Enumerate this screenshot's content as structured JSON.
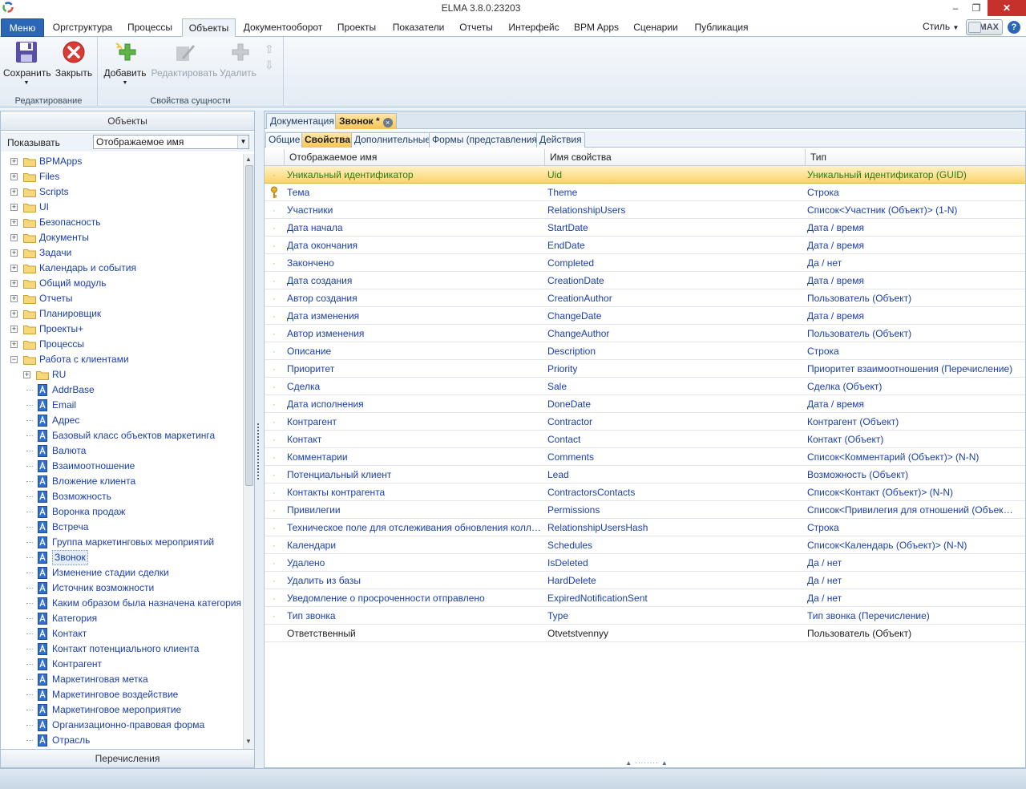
{
  "window": {
    "title": "ELMA 3.8.0.23203"
  },
  "menu": {
    "tabs": [
      {
        "label": "Меню",
        "kind": "menu"
      },
      {
        "label": "Оргструктура"
      },
      {
        "label": "Процессы"
      },
      {
        "label": "Объекты",
        "active": true
      },
      {
        "label": "Документооборот"
      },
      {
        "label": "Проекты"
      },
      {
        "label": "Показатели"
      },
      {
        "label": "Отчеты"
      },
      {
        "label": "Интерфейс"
      },
      {
        "label": "BPM Apps"
      },
      {
        "label": "Сценарии"
      },
      {
        "label": "Публикация"
      }
    ],
    "style_label": "Стиль",
    "max_label": "MAX",
    "help": "?"
  },
  "ribbon": {
    "groups": [
      {
        "label": "Редактирование",
        "buttons": [
          {
            "label": "Сохранить",
            "icon": "save-icon",
            "enabled": true
          },
          {
            "label": "Закрыть",
            "icon": "close-icon",
            "enabled": true
          }
        ]
      },
      {
        "label": "Свойства сущности",
        "buttons": [
          {
            "label": "Добавить",
            "icon": "add-icon",
            "enabled": true
          },
          {
            "label": "Редактировать",
            "icon": "edit-icon",
            "enabled": false
          },
          {
            "label": "Удалить",
            "icon": "delete-icon",
            "enabled": false
          }
        ]
      }
    ]
  },
  "left": {
    "header": "Объекты",
    "show_label": "Показывать",
    "show_value": "Отображаемое имя",
    "footer": "Перечисления",
    "tree": [
      {
        "label": "BPMApps",
        "type": "folder",
        "level": 0,
        "exp": "+"
      },
      {
        "label": "Files",
        "type": "folder",
        "level": 0,
        "exp": "+"
      },
      {
        "label": "Scripts",
        "type": "folder",
        "level": 0,
        "exp": "+"
      },
      {
        "label": "UI",
        "type": "folder",
        "level": 0,
        "exp": "+"
      },
      {
        "label": "Безопасность",
        "type": "folder",
        "level": 0,
        "exp": "+"
      },
      {
        "label": "Документы",
        "type": "folder",
        "level": 0,
        "exp": "+"
      },
      {
        "label": "Задачи",
        "type": "folder",
        "level": 0,
        "exp": "+"
      },
      {
        "label": "Календарь и события",
        "type": "folder",
        "level": 0,
        "exp": "+"
      },
      {
        "label": "Общий модуль",
        "type": "folder",
        "level": 0,
        "exp": "+"
      },
      {
        "label": "Отчеты",
        "type": "folder",
        "level": 0,
        "exp": "+"
      },
      {
        "label": "Планировщик",
        "type": "folder",
        "level": 0,
        "exp": "+"
      },
      {
        "label": "Проекты+",
        "type": "folder",
        "level": 0,
        "exp": "+"
      },
      {
        "label": "Процессы",
        "type": "folder",
        "level": 0,
        "exp": "+"
      },
      {
        "label": "Работа с клиентами",
        "type": "folder",
        "level": 0,
        "exp": "−"
      },
      {
        "label": "RU",
        "type": "folder",
        "level": 1,
        "exp": "+"
      },
      {
        "label": "AddrBase",
        "type": "entity",
        "level": 1
      },
      {
        "label": "Email",
        "type": "entity",
        "level": 1
      },
      {
        "label": "Адрес",
        "type": "entity",
        "level": 1
      },
      {
        "label": "Базовый класс объектов маркетинга",
        "type": "entity",
        "level": 1
      },
      {
        "label": "Валюта",
        "type": "entity",
        "level": 1
      },
      {
        "label": "Взаимоотношение",
        "type": "entity",
        "level": 1
      },
      {
        "label": "Вложение клиента",
        "type": "entity",
        "level": 1
      },
      {
        "label": "Возможность",
        "type": "entity",
        "level": 1
      },
      {
        "label": "Воронка продаж",
        "type": "entity",
        "level": 1
      },
      {
        "label": "Встреча",
        "type": "entity",
        "level": 1
      },
      {
        "label": "Группа маркетинговых мероприятий",
        "type": "entity",
        "level": 1
      },
      {
        "label": "Звонок",
        "type": "entity",
        "level": 1,
        "selected": true
      },
      {
        "label": "Изменение стадии сделки",
        "type": "entity",
        "level": 1
      },
      {
        "label": "Источник возможности",
        "type": "entity",
        "level": 1
      },
      {
        "label": "Каким образом была назначена категория",
        "type": "entity",
        "level": 1
      },
      {
        "label": "Категория",
        "type": "entity",
        "level": 1
      },
      {
        "label": "Контакт",
        "type": "entity",
        "level": 1
      },
      {
        "label": "Контакт потенциального клиента",
        "type": "entity",
        "level": 1
      },
      {
        "label": "Контрагент",
        "type": "entity",
        "level": 1
      },
      {
        "label": "Маркетинговая метка",
        "type": "entity",
        "level": 1
      },
      {
        "label": "Маркетинговое воздействие",
        "type": "entity",
        "level": 1
      },
      {
        "label": "Маркетинговое мероприятие",
        "type": "entity",
        "level": 1
      },
      {
        "label": "Организационно-правовая форма",
        "type": "entity",
        "level": 1
      },
      {
        "label": "Отрасль",
        "type": "entity",
        "level": 1
      }
    ]
  },
  "right": {
    "doc_tabs": [
      {
        "label": "Документация"
      },
      {
        "label": "Звонок *",
        "active": true,
        "close": "×"
      }
    ],
    "sub_tabs": [
      {
        "label": "Общие"
      },
      {
        "label": "Свойства",
        "active": true
      },
      {
        "label": "Дополнительные"
      },
      {
        "label": "Формы (представления)"
      },
      {
        "label": "Действия"
      }
    ],
    "columns": [
      "Отображаемое имя",
      "Имя свойства",
      "Тип"
    ],
    "rows": [
      {
        "mark": "·",
        "display": "Уникальный идентификатор",
        "name": "Uid",
        "type": "Уникальный идентификатор (GUID)",
        "selected": true
      },
      {
        "mark": "key",
        "display": "Тема",
        "name": "Theme",
        "type": "Строка"
      },
      {
        "mark": "·",
        "display": "Участники",
        "name": "RelationshipUsers",
        "type": "Список<Участник (Объект)> (1-N)"
      },
      {
        "mark": "·",
        "display": "Дата начала",
        "name": "StartDate",
        "type": "Дата / время"
      },
      {
        "mark": "·",
        "display": "Дата окончания",
        "name": "EndDate",
        "type": "Дата / время"
      },
      {
        "mark": "·",
        "display": "Закончено",
        "name": "Completed",
        "type": "Да / нет"
      },
      {
        "mark": "·",
        "display": "Дата создания",
        "name": "CreationDate",
        "type": "Дата / время"
      },
      {
        "mark": "·",
        "display": "Автор создания",
        "name": "CreationAuthor",
        "type": "Пользователь (Объект)"
      },
      {
        "mark": "·",
        "display": "Дата изменения",
        "name": "ChangeDate",
        "type": "Дата / время"
      },
      {
        "mark": "·",
        "display": "Автор изменения",
        "name": "ChangeAuthor",
        "type": "Пользователь (Объект)"
      },
      {
        "mark": "·",
        "display": "Описание",
        "name": "Description",
        "type": "Строка"
      },
      {
        "mark": "·",
        "display": "Приоритет",
        "name": "Priority",
        "type": "Приоритет взаимоотношения (Перечисление)"
      },
      {
        "mark": "·",
        "display": "Сделка",
        "name": "Sale",
        "type": "Сделка (Объект)"
      },
      {
        "mark": "·",
        "display": "Дата исполнения",
        "name": "DoneDate",
        "type": "Дата / время"
      },
      {
        "mark": "·",
        "display": "Контрагент",
        "name": "Contractor",
        "type": "Контрагент (Объект)"
      },
      {
        "mark": "·",
        "display": "Контакт",
        "name": "Contact",
        "type": "Контакт (Объект)"
      },
      {
        "mark": "·",
        "display": "Комментарии",
        "name": "Comments",
        "type": "Список<Комментарий (Объект)> (N-N)"
      },
      {
        "mark": "·",
        "display": "Потенциальный клиент",
        "name": "Lead",
        "type": "Возможность (Объект)"
      },
      {
        "mark": "·",
        "display": "Контакты контрагента",
        "name": "ContractorsContacts",
        "type": "Список<Контакт (Объект)> (N-N)"
      },
      {
        "mark": "·",
        "display": "Привилегии",
        "name": "Permissions",
        "type": "Список<Привилегия для отношений (Объект)..."
      },
      {
        "mark": "·",
        "display": "Техническое поле для отслеживания обновления коллекции...",
        "name": "RelationshipUsersHash",
        "type": "Строка"
      },
      {
        "mark": "·",
        "display": "Календари",
        "name": "Schedules",
        "type": "Список<Календарь (Объект)> (N-N)"
      },
      {
        "mark": "·",
        "display": "Удалено",
        "name": "IsDeleted",
        "type": "Да / нет"
      },
      {
        "mark": "·",
        "display": "Удалить из базы",
        "name": "HardDelete",
        "type": "Да / нет"
      },
      {
        "mark": "·",
        "display": "Уведомление о просроченности отправлено",
        "name": "ExpiredNotificationSent",
        "type": "Да / нет"
      },
      {
        "mark": "·",
        "display": "Тип звонка",
        "name": "Type",
        "type": "Тип звонка (Перечисление)"
      },
      {
        "mark": "",
        "display": "Ответственный",
        "name": "Otvetstvennyy",
        "type": "Пользователь (Объект)",
        "plain": true
      }
    ]
  },
  "colors": {
    "accent": "#2b67b5",
    "selection": "#fbd36b",
    "link": "#1b3faa"
  }
}
